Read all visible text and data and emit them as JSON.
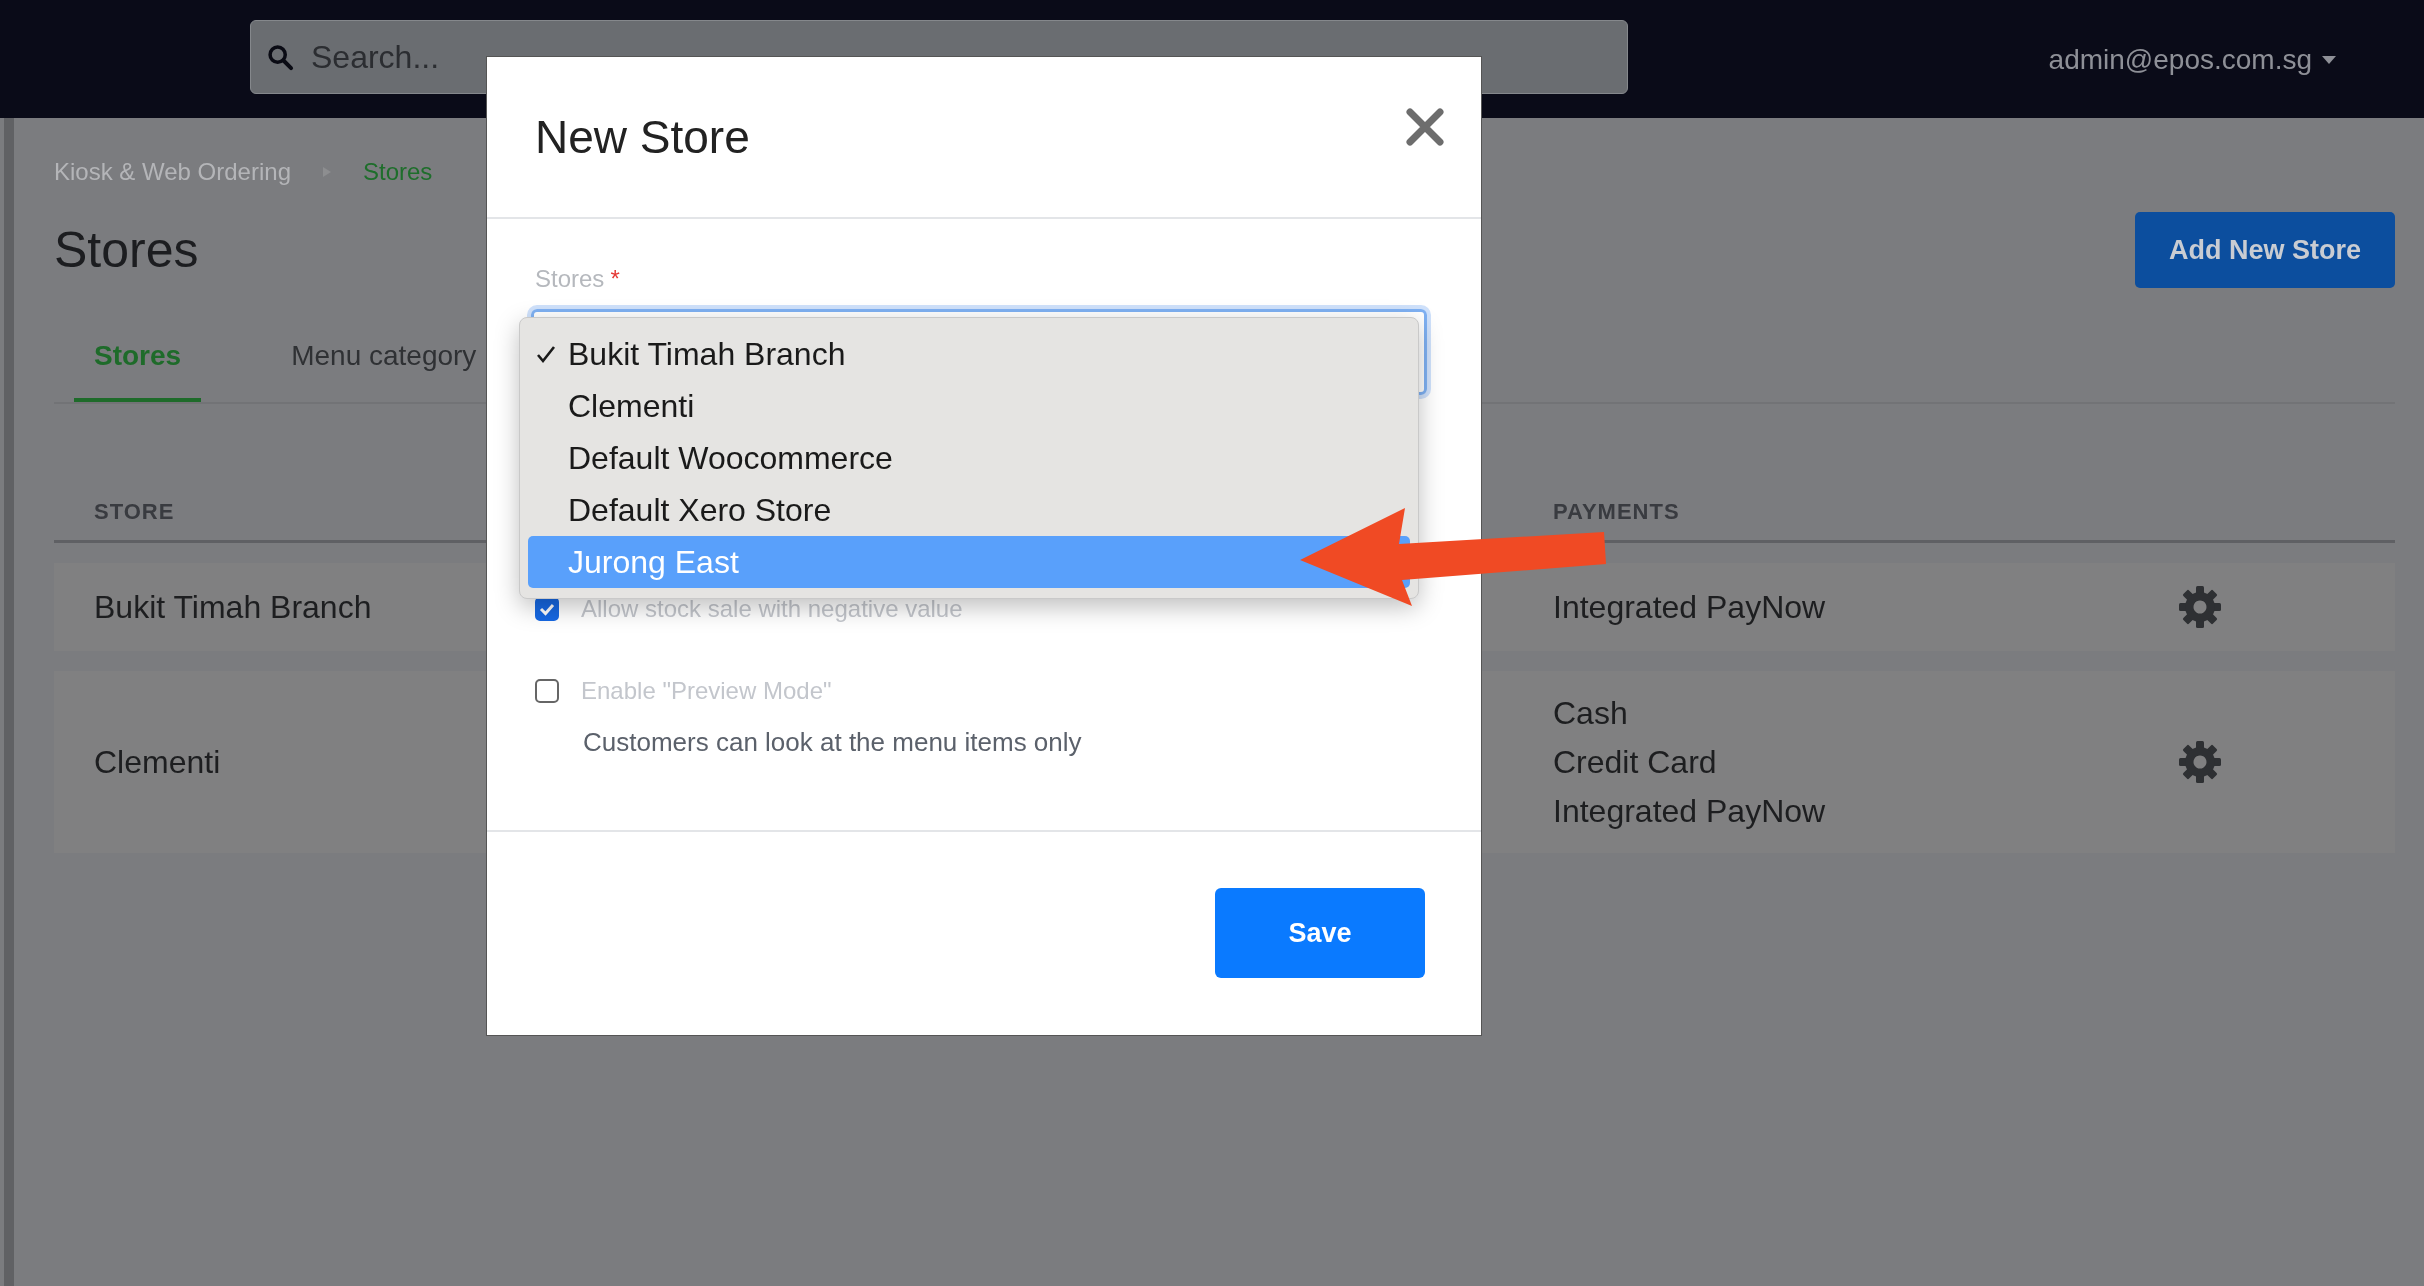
{
  "topbar": {
    "search": {
      "placeholder": "Search..."
    },
    "user_menu": "admin@epos.com.sg"
  },
  "breadcrumb": [
    {
      "label": "Kiosk & Web Ordering",
      "current": false
    },
    {
      "label": "Stores",
      "current": true
    }
  ],
  "page_title": "Stores",
  "add_button": "Add New Store",
  "tabs": [
    {
      "label": "Stores",
      "selected": true
    },
    {
      "label": "Menu category",
      "selected": false
    }
  ],
  "table": {
    "columns": [
      "STORE",
      "PAYMENTS"
    ],
    "rows": [
      {
        "store": "Bukit Timah Branch",
        "payments": [
          "Integrated PayNow"
        ]
      },
      {
        "store": "Clementi",
        "payments": [
          "Cash",
          "Credit Card",
          "Integrated PayNow"
        ]
      }
    ]
  },
  "modal": {
    "title": "New Store",
    "stores_field": {
      "label": "Stores",
      "required_mark": "*",
      "options": [
        {
          "label": "Bukit Timah Branch",
          "selected": true,
          "highlighted": false
        },
        {
          "label": "Clementi",
          "selected": false,
          "highlighted": false
        },
        {
          "label": "Default Woocommerce",
          "selected": false,
          "highlighted": false
        },
        {
          "label": "Default Xero Store",
          "selected": false,
          "highlighted": false
        },
        {
          "label": "Jurong East",
          "selected": false,
          "highlighted": true
        }
      ]
    },
    "checkboxes": [
      {
        "label": "Allow stock sale with negative value",
        "checked": true
      },
      {
        "label": "Enable \"Preview Mode\"",
        "checked": false,
        "hint": "Customers can look at the menu items only"
      }
    ],
    "save_button": "Save"
  }
}
